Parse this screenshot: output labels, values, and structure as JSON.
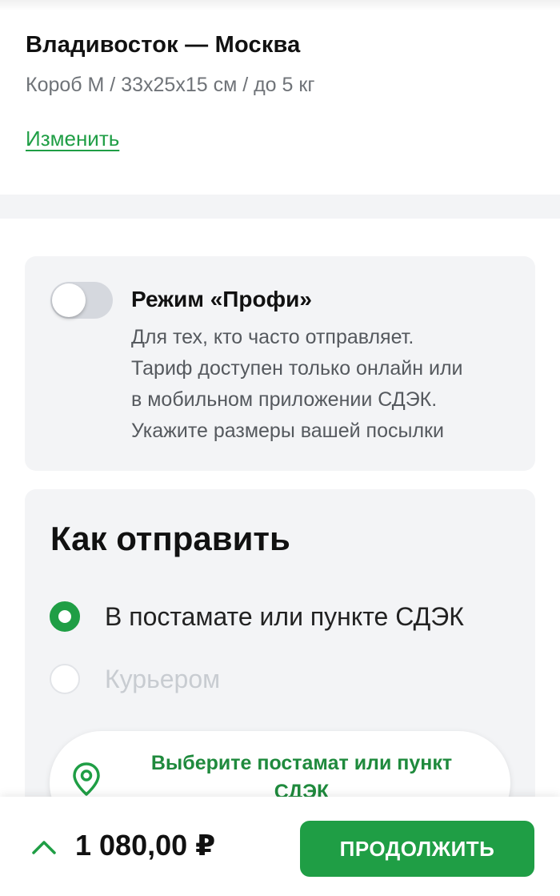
{
  "route": {
    "title": "Владивосток — Москва",
    "details": "Короб M / 33x25x15 см / до 5 кг",
    "change_link": "Изменить"
  },
  "profi_mode": {
    "enabled": false,
    "title": "Режим «Профи»",
    "description_lines": [
      "Для тех, кто часто отправляет.",
      "Тариф доступен только онлайн или",
      "в мобильном приложении СДЭК.",
      "Укажите размеры вашей посылки"
    ]
  },
  "send_method": {
    "title": "Как отправить",
    "options": [
      {
        "label": "В постамате или пункте СДЭК",
        "selected": true,
        "enabled": true
      },
      {
        "label": "Курьером",
        "selected": false,
        "enabled": false
      }
    ],
    "pickup_button": {
      "label": "Выберите постамат или пункт СДЭК",
      "icon": "location-pin-icon"
    }
  },
  "footer": {
    "expand_icon": "chevron-up-icon",
    "price": "1 080,00 ₽",
    "continue_label": "ПРОДОЛЖИТЬ"
  },
  "colors": {
    "accent": "#1f9e45",
    "accent_text": "#1f8a3d",
    "card_bg": "#f3f4f6",
    "muted_text": "#6f7378",
    "disabled_text": "#c8ccd1"
  }
}
